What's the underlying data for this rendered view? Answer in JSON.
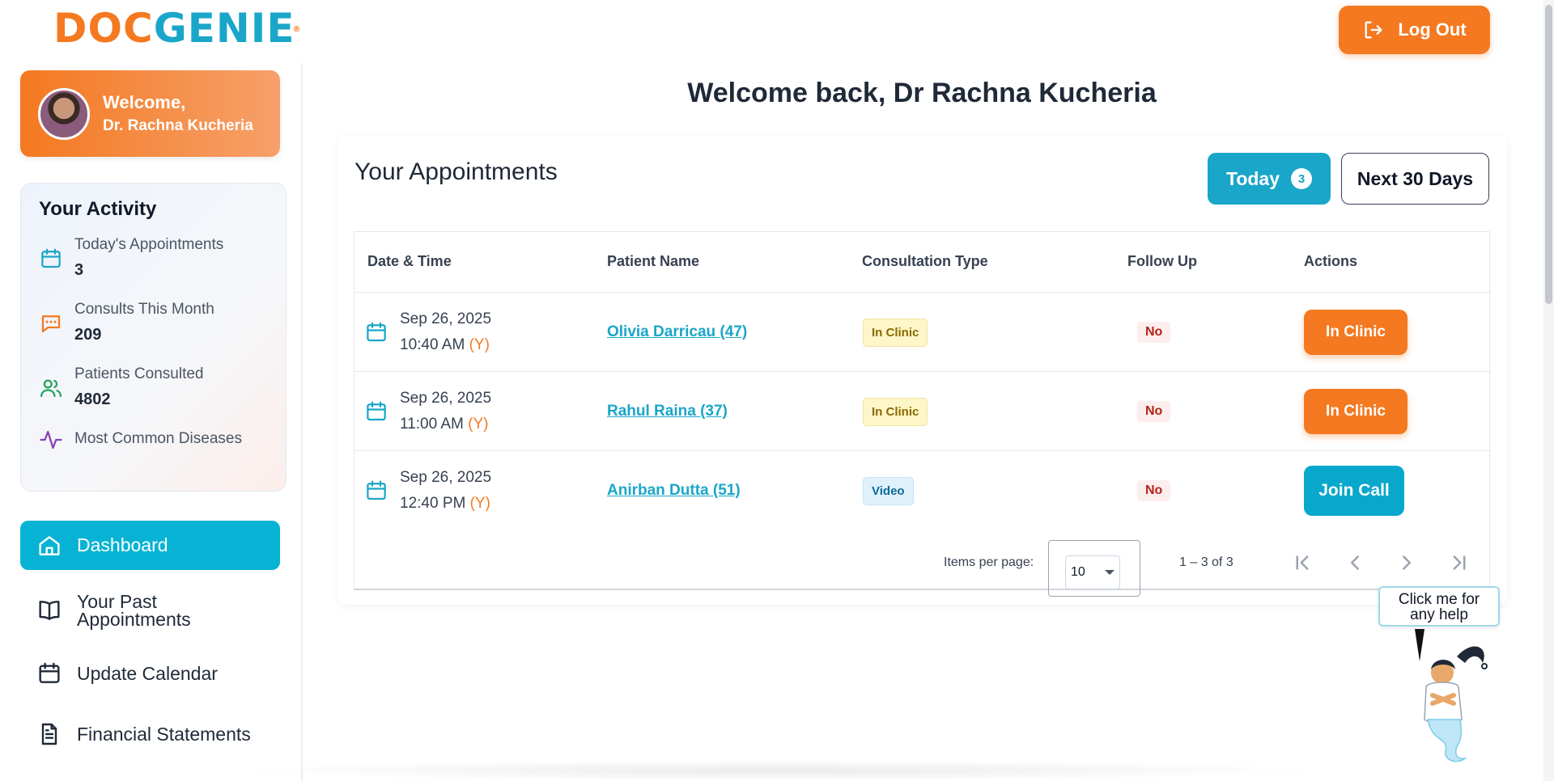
{
  "brand": {
    "logo_part1": "DOC",
    "logo_part2": "GENIE",
    "logo_reg": "®"
  },
  "header": {
    "logout_label": "Log Out"
  },
  "sidebar": {
    "welcome_line1": "Welcome,",
    "welcome_line2": "Dr. Rachna Kucheria",
    "activity": {
      "title": "Your Activity",
      "items": [
        {
          "label": "Today's Appointments",
          "value": "3",
          "icon": "calendar-icon"
        },
        {
          "label": "Consults This Month",
          "value": "209",
          "icon": "chat-icon"
        },
        {
          "label": "Patients Consulted",
          "value": "4802",
          "icon": "users-icon"
        },
        {
          "label": "Most Common Diseases",
          "value": "",
          "icon": "activity-pulse-icon"
        }
      ]
    },
    "nav": [
      {
        "label": "Dashboard",
        "icon": "home-icon",
        "active": true
      },
      {
        "label": "Your Past Appointments",
        "icon": "book-icon",
        "active": false
      },
      {
        "label": "Update Calendar",
        "icon": "calendar-icon",
        "active": false
      },
      {
        "label": "Financial Statements",
        "icon": "document-icon",
        "active": false
      }
    ]
  },
  "main": {
    "title": "Welcome back, Dr Rachna Kucheria",
    "appointments": {
      "title": "Your Appointments",
      "tab_today": "Today",
      "tab_today_count": "3",
      "tab_next": "Next 30 Days",
      "columns": [
        "Date & Time",
        "Patient Name",
        "Consultation Type",
        "Follow Up",
        "Actions"
      ],
      "rows": [
        {
          "date": "Sep 26, 2025",
          "time": "10:40 AM",
          "flag": "(Y)",
          "patient": "Olivia Darricau (47)",
          "type": "In Clinic",
          "follow_up": "No",
          "action": "In Clinic"
        },
        {
          "date": "Sep 26, 2025",
          "time": "11:00 AM",
          "flag": "(Y)",
          "patient": "Rahul Raina (37)",
          "type": "In Clinic",
          "follow_up": "No",
          "action": "In Clinic"
        },
        {
          "date": "Sep 26, 2025",
          "time": "12:40 PM",
          "flag": "(Y)",
          "patient": "Anirban Dutta (51)",
          "type": "Video",
          "follow_up": "No",
          "action": "Join Call"
        }
      ],
      "pager": {
        "items_per_page_label": "Items per page:",
        "items_per_page": "10",
        "range": "1 – 3 of 3"
      }
    }
  },
  "help": {
    "bubble_line1": "Click me for",
    "bubble_line2": "any help"
  },
  "colors": {
    "brand_orange": "#f47920",
    "brand_blue": "#1aa6c8",
    "active_nav": "#07b3d4"
  }
}
